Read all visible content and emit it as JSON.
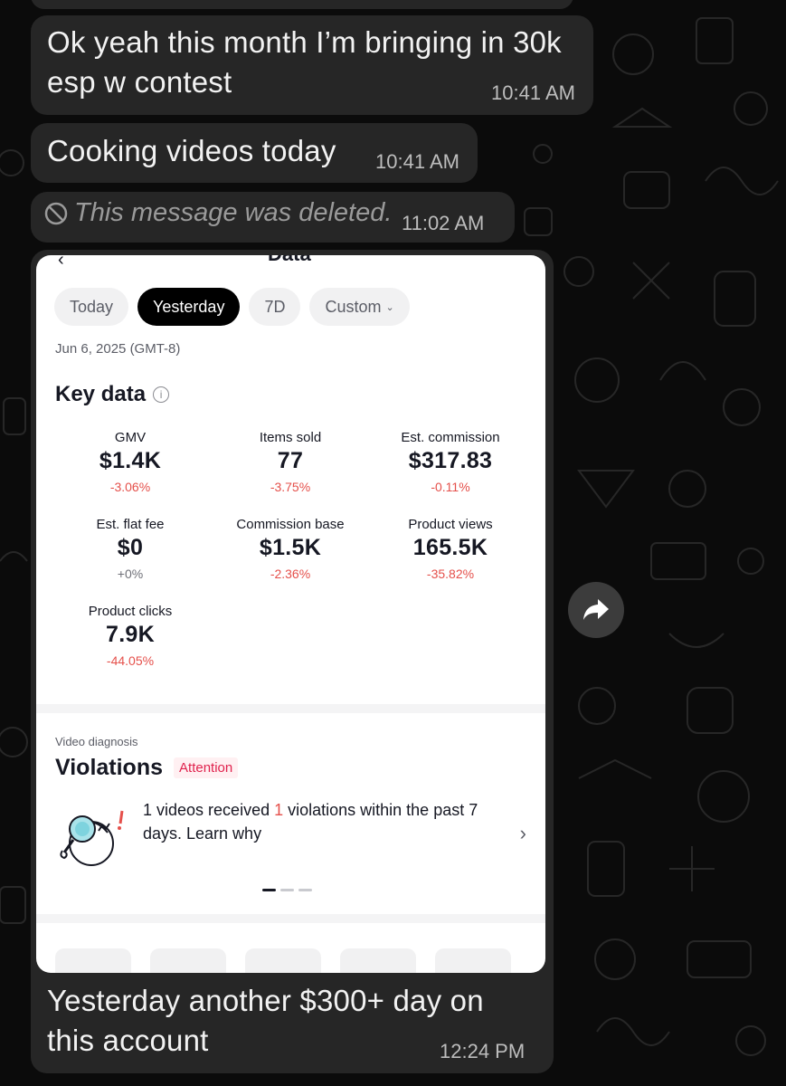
{
  "messages": [
    {
      "text_line1": "Ok yeah this month I’m bringing in 30k",
      "text_line2": "esp w contest",
      "time": "10:41 AM"
    },
    {
      "text": "Cooking videos today",
      "time": "10:41 AM"
    },
    {
      "deleted_text": "This message was deleted.",
      "time": "11:02 AM",
      "icon": "prohibited-icon"
    },
    {
      "text_line1": "Yesterday another $300+ day on",
      "text_line2": "this account",
      "time": "12:24 PM"
    }
  ],
  "screenshot": {
    "cut_title": "Data",
    "back_icon": "chevron-left-icon",
    "tabs": [
      {
        "label": "Today",
        "active": false
      },
      {
        "label": "Yesterday",
        "active": true
      },
      {
        "label": "7D",
        "active": false
      },
      {
        "label": "Custom",
        "active": false,
        "icon": "chevron-down-icon"
      }
    ],
    "date_range": "Jun 6, 2025 (GMT-8)",
    "key_data": {
      "title": "Key data",
      "info_icon": "info-icon",
      "metrics": [
        {
          "label": "GMV",
          "value": "$1.4K",
          "change": "-3.06%"
        },
        {
          "label": "Items sold",
          "value": "77",
          "change": "-3.75%"
        },
        {
          "label": "Est. commission",
          "value": "$317.83",
          "change": "-0.11%"
        },
        {
          "label": "Est. flat fee",
          "value": "$0",
          "change": "+0%"
        },
        {
          "label": "Commission base",
          "value": "$1.5K",
          "change": "-2.36%"
        },
        {
          "label": "Product views",
          "value": "165.5K",
          "change": "-35.82%"
        },
        {
          "label": "Product clicks",
          "value": "7.9K",
          "change": "-44.05%"
        }
      ]
    },
    "video_diagnosis": {
      "section_label": "Video diagnosis",
      "title": "Violations",
      "badge": "Attention",
      "count_videos": "1",
      "text_a": " videos received ",
      "count_violations": "1",
      "text_b": " violations within the past 7 days. Learn why",
      "illustration_icon": "magnifier-person-icon",
      "chevron_icon": "chevron-right-icon"
    }
  },
  "colors": {
    "bubble": "#262626",
    "background": "#0b0b0b",
    "negative": "#e5504b",
    "attention": "#e0234e"
  },
  "forward_icon": "forward-arrow-icon"
}
